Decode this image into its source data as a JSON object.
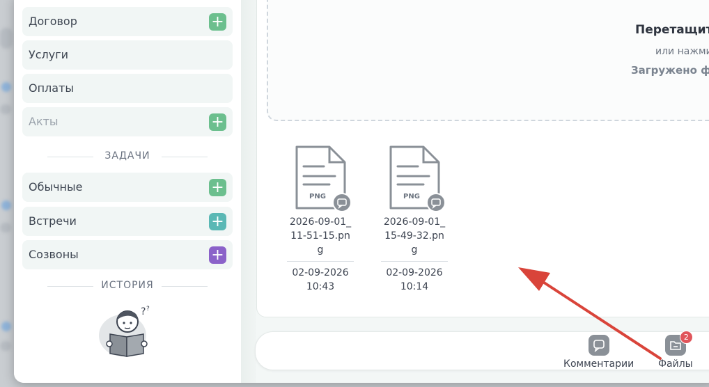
{
  "sidebar": {
    "items": [
      {
        "label": "Договор",
        "has_add": true,
        "add_color": "#6cbf8e",
        "disabled": false
      },
      {
        "label": "Услуги",
        "has_add": false,
        "disabled": false
      },
      {
        "label": "Оплаты",
        "has_add": false,
        "disabled": false
      },
      {
        "label": "Акты",
        "has_add": true,
        "add_color": "#6cbf8e",
        "disabled": true
      }
    ],
    "tasks_title": "ЗАДАЧИ",
    "task_items": [
      {
        "label": "Обычные",
        "add_color": "#6cbf8e"
      },
      {
        "label": "Встречи",
        "add_color": "#5bb8b5"
      },
      {
        "label": "Созвоны",
        "add_color": "#8b62c9"
      }
    ],
    "add_symbol": "+",
    "history_title": "ИСТОРИЯ"
  },
  "dropzone": {
    "title": "Перетащите",
    "subtitle": "или нажмит",
    "uploaded": "Загружено фа"
  },
  "files": [
    {
      "type": "PNG",
      "name": "2026-09-01_11-51-15.png",
      "date": "02-09-2026",
      "time": "10:43"
    },
    {
      "type": "PNG",
      "name": "2026-09-01_15-49-32.png",
      "date": "02-09-2026",
      "time": "10:14"
    }
  ],
  "bottom_bar": {
    "comments_label": "Комментарии",
    "files_label": "Файлы",
    "files_badge": "2"
  },
  "colors": {
    "arrow": "#d9443a",
    "accent_green": "#6cbf8e",
    "accent_teal": "#5bb8b5",
    "accent_purple": "#8b62c9"
  }
}
